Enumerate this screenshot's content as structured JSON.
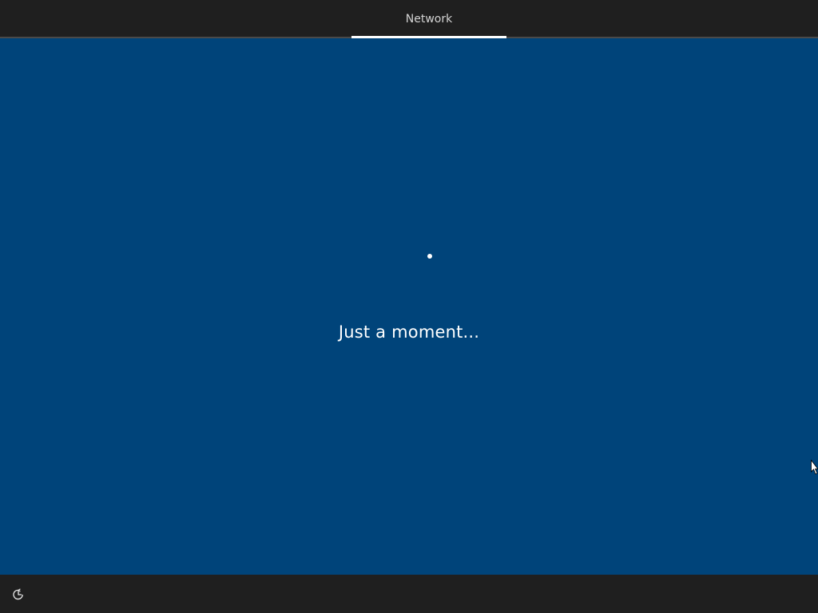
{
  "header": {
    "step_label": "Network"
  },
  "main": {
    "status_text": "Just a moment..."
  },
  "footer": {
    "ease_of_access_icon": "ease-of-access-icon"
  },
  "colors": {
    "background": "#00447a",
    "bar": "#1f1f1f",
    "text": "#ffffff"
  }
}
